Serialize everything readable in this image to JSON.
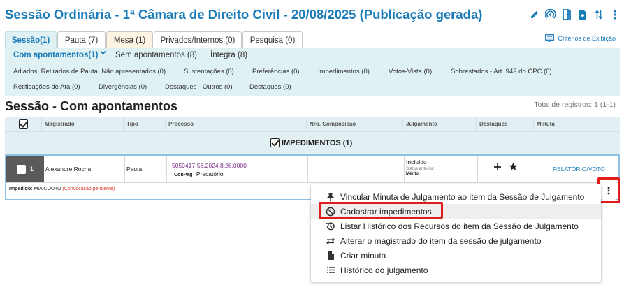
{
  "page": {
    "title": "Sessão Ordinária - 1ª Câmara de Direito Civil - 20/08/2025 (Publicação gerada)"
  },
  "header_icons": [
    "pencil-icon",
    "broadcast-icon",
    "door-exit-icon",
    "file-add-icon",
    "sort-icon",
    "more-vertical-icon"
  ],
  "tabs": [
    {
      "label": "Sessão(1)"
    },
    {
      "label": "Pauta (7)"
    },
    {
      "label": "Mesa (1)"
    },
    {
      "label": "Privados/Internos (0)"
    },
    {
      "label": "Pesquisa (0)"
    }
  ],
  "criteria_label": "Critérios de Exibição",
  "subtabs": [
    {
      "label": "Com apontamentos(1)"
    },
    {
      "label": "Sem apontamentos (8)"
    },
    {
      "label": "Íntegra (8)"
    }
  ],
  "chips_row1": [
    "Adiados, Retirados de Pauta, Não apresentados (0)",
    "Sustentações (0)",
    "Preferências (0)",
    "Impedimentos (0)",
    "Votos-Vista (0)",
    "Sobrestados - Art. 942 do CPC (0)"
  ],
  "chips_row2": [
    "Retificações de Ata (0)",
    "Divergências (0)",
    "Destaques - Outros (0)",
    "Destaques (0)"
  ],
  "section": {
    "title": "Sessão - Com apontamentos",
    "total": "Total de registros: 1 (1-1)"
  },
  "columns": [
    "Magistrado",
    "Tipo",
    "Processo",
    "Nro. Composicao",
    "Julgamento",
    "Destaques",
    "Minuta"
  ],
  "group": {
    "label": "IMPEDIMENTOS (1)"
  },
  "row": {
    "number": "1",
    "magistrado": "Alexandre Rocha",
    "tipo": "Pauta",
    "processo": "5059417-56.2024.8.26.0000",
    "conpag": "ConPag",
    "classe": "Precatório",
    "julgamento_status": "Incluído",
    "status_anterior_label": "Status anterior:",
    "status_anterior": "Mérito",
    "minuta_link": "RELATÓRIO/VOTO",
    "impedido_label": "Impedido:",
    "impedido_name": "MIA COUTO",
    "impedido_status": "(Convocação pendente)"
  },
  "menu": [
    {
      "label": "Vincular Minuta de Julgamento ao item da Sessão de Julgamento",
      "icon": "pin-icon"
    },
    {
      "label": "Cadastrar impedimentos",
      "icon": "block-icon"
    },
    {
      "label": "Listar Histórico dos Recursos do item da Sessão de Julgamento",
      "icon": "history-icon"
    },
    {
      "label": "Alterar o magistrado do item da sessão de julgamento",
      "icon": "swap-icon"
    },
    {
      "label": "Criar minuta",
      "icon": "document-icon"
    },
    {
      "label": "Histórico do julgamento",
      "icon": "list-icon"
    }
  ]
}
